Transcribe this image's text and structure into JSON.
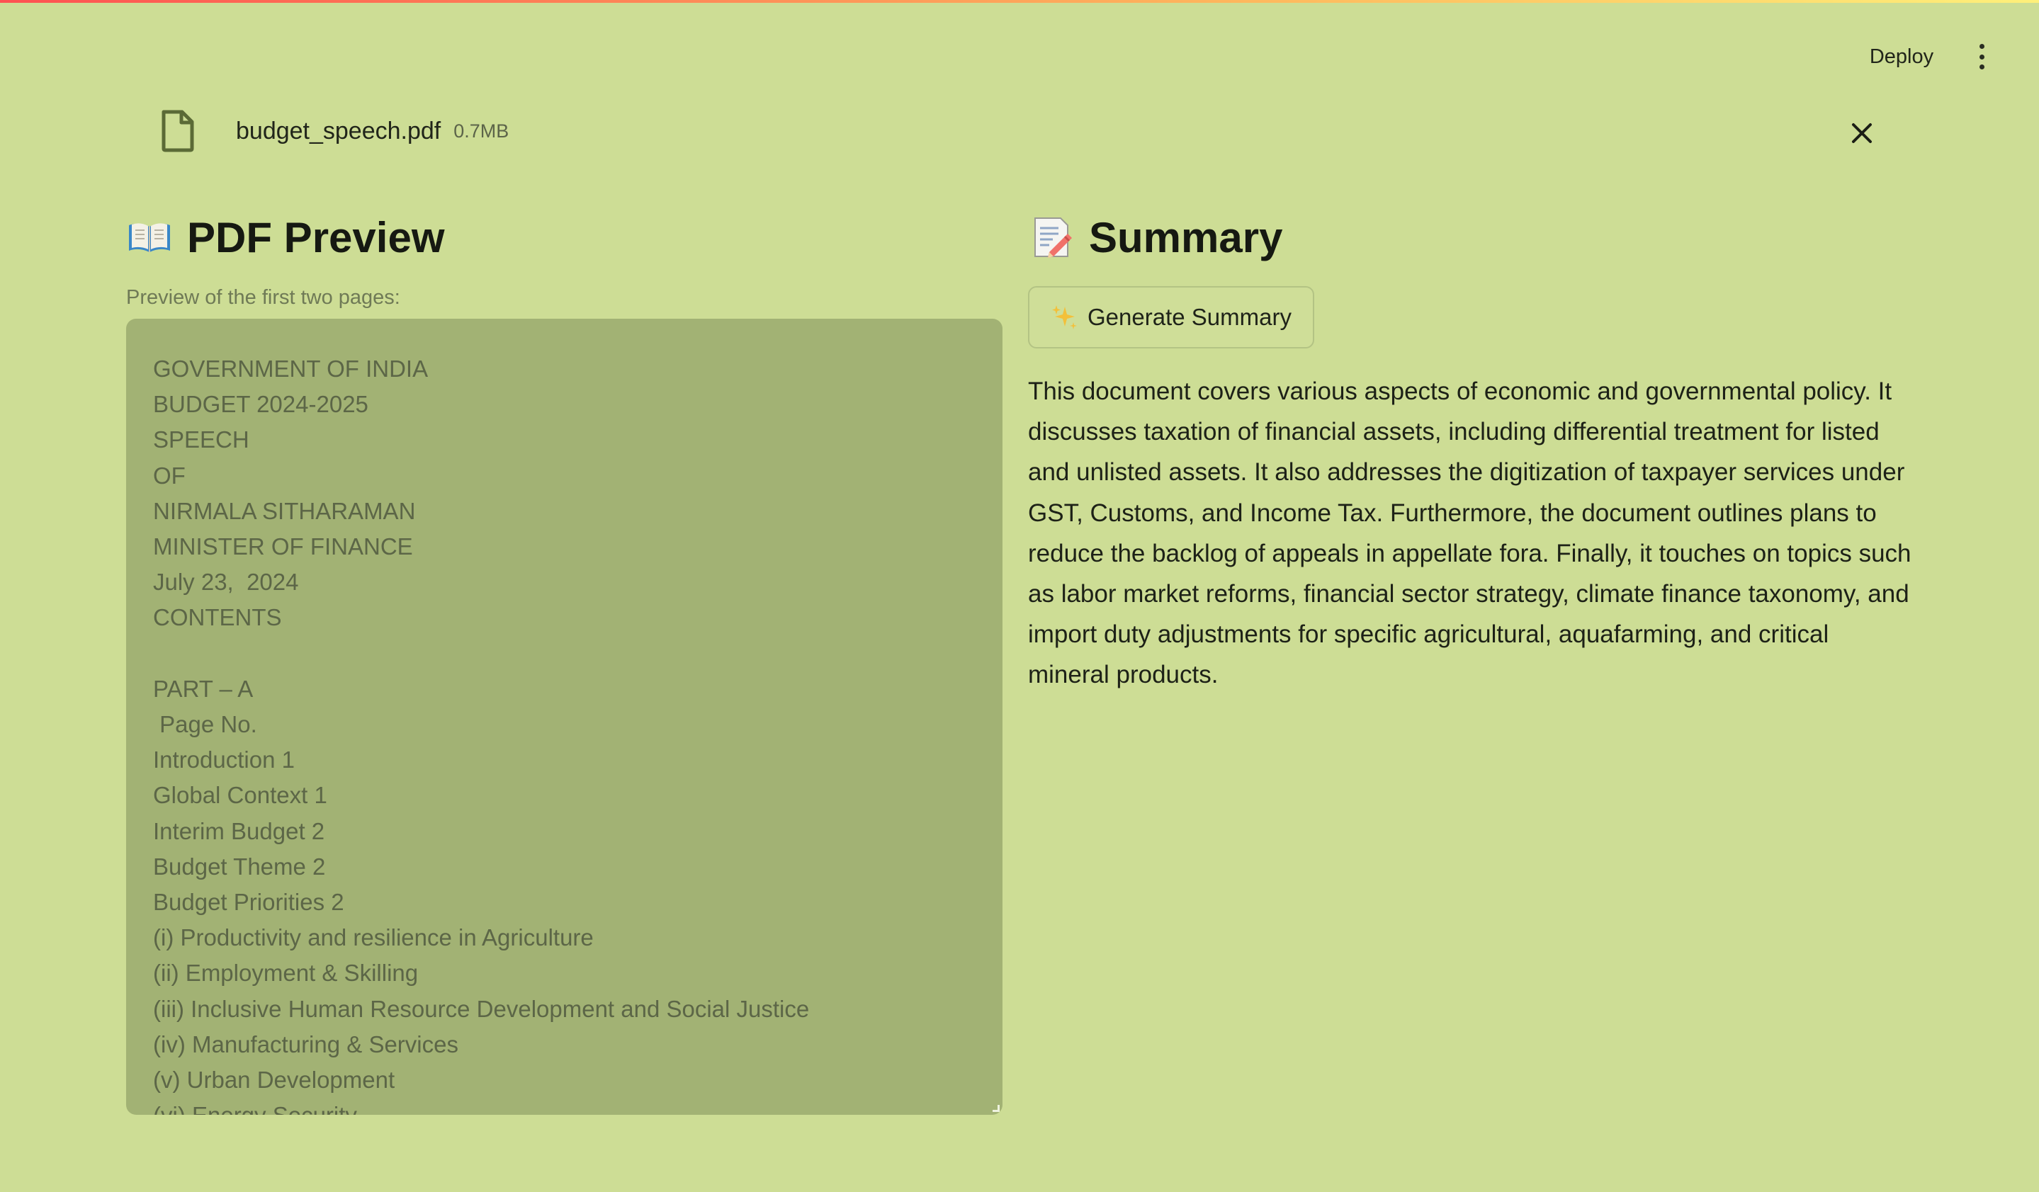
{
  "app": {
    "deploy_label": "Deploy",
    "menu_icon": "kebab-menu-icon"
  },
  "upload": {
    "file_name": "budget_speech.pdf",
    "file_size": "0.7MB",
    "file_icon": "file-icon",
    "remove_icon": "close-icon"
  },
  "preview": {
    "emoji": "open-book-icon",
    "title": "PDF Preview",
    "caption": "Preview of the first two pages:",
    "text": "GOVERNMENT OF INDIA\nBUDGET 2024-2025\nSPEECH\nOF\nNIRMALA SITHARAMAN\nMINISTER OF FINANCE\nJuly 23,  2024\nCONTENTS\n\nPART – A\n Page No.\nIntroduction 1\nGlobal Context 1\nInterim Budget 2\nBudget Theme 2\nBudget Priorities 2\n(i) Productivity and resilience in Agriculture\n(ii) Employment & Skilling\n(iii) Inclusive Human Resource Development and Social Justice\n(iv) Manufacturing & Services\n(v) Urban Development\n(vi) Energy Security"
  },
  "summary": {
    "emoji": "memo-icon",
    "title": "Summary",
    "button_label": "Generate Summary",
    "button_icon": "sparkles-icon",
    "text": "This document covers various aspects of economic and governmental policy. It discusses taxation of financial assets, including differential treatment for listed and unlisted assets. It also addresses the digitization of taxpayer services under GST, Customs, and Income Tax. Furthermore, the document outlines plans to reduce the backlog of appeals in appellate fora. Finally, it touches on topics such as labor market reforms, financial sector strategy, climate finance taxonomy, and import duty adjustments for specific agricultural, aquafarming, and critical mineral products."
  },
  "colors": {
    "background": "#cddd95",
    "preview_box": "#a2b274",
    "accent_top_bar_start": "#ff5252",
    "accent_top_bar_end": "#fff07a"
  }
}
